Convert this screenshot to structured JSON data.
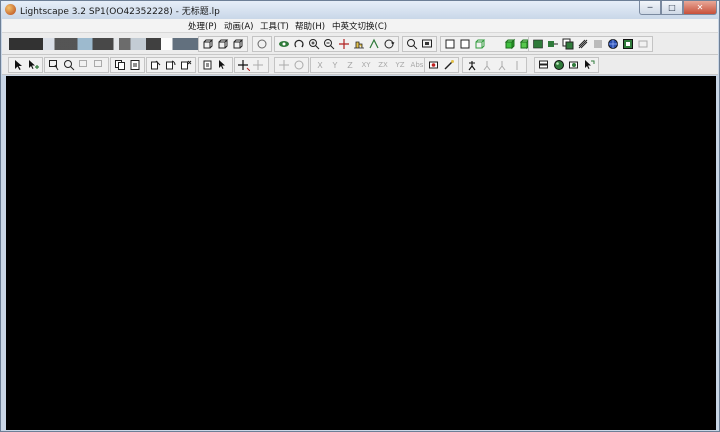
{
  "window": {
    "title": "Lightscape 3.2 SP1(OO42352228)  - 无标题.lp",
    "controls": {
      "minimize": "─",
      "maximize": "□",
      "close": "✕"
    }
  },
  "menu": {
    "items": [
      "处理(P)",
      "动画(A)",
      "工具(T)",
      "帮助(H)",
      "中英文切换(C)"
    ]
  },
  "colors": {
    "viewport_bg": "#000000",
    "toolbar_bg": "#ececec",
    "titlebar": "#c9d7e8"
  },
  "toolbar_row2": {
    "axis_labels": [
      "X",
      "Y",
      "Z",
      "XY",
      "ZX",
      "YZ",
      "Abs"
    ]
  }
}
